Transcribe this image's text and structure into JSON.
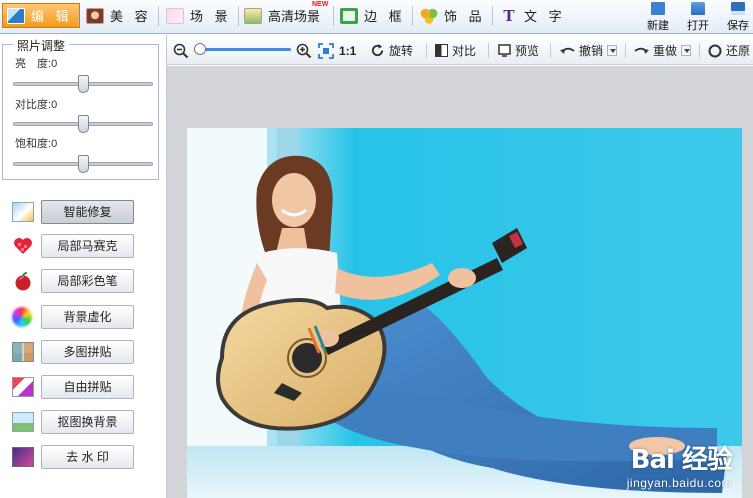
{
  "menu": {
    "tabs": [
      {
        "label": "编 辑",
        "icon": "edit-icon"
      },
      {
        "label": "美 容",
        "icon": "beauty-icon"
      },
      {
        "label": "场 景",
        "icon": "scene-icon"
      },
      {
        "label": "高清场景",
        "icon": "hd-scene-icon"
      },
      {
        "label": "边 框",
        "icon": "frame-icon"
      },
      {
        "label": "饰 品",
        "icon": "accessory-icon"
      },
      {
        "label": "文 字",
        "icon": "text-icon"
      }
    ],
    "new_badge": "NEW",
    "actions": [
      {
        "label": "新建",
        "icon": "new-file-icon"
      },
      {
        "label": "打开",
        "icon": "open-folder-icon"
      },
      {
        "label": "保存",
        "icon": "save-icon"
      }
    ]
  },
  "adjust": {
    "title": "照片调整",
    "sliders": [
      {
        "label": "亮　度:",
        "value": "0",
        "level": 0.5
      },
      {
        "label": "对比度:",
        "value": "0",
        "level": 0.5
      },
      {
        "label": "饱和度:",
        "value": "0",
        "level": 0.5
      }
    ]
  },
  "tools": [
    {
      "label": "智能修复",
      "icon": "smart-repair-icon",
      "selected": true
    },
    {
      "label": "局部马赛克",
      "icon": "mosaic-heart-icon",
      "selected": false
    },
    {
      "label": "局部彩色笔",
      "icon": "color-pen-apple-icon",
      "selected": false
    },
    {
      "label": "背景虚化",
      "icon": "background-blur-icon",
      "selected": false
    },
    {
      "label": "多图拼贴",
      "icon": "multi-collage-icon",
      "selected": false
    },
    {
      "label": "自由拼贴",
      "icon": "free-collage-icon",
      "selected": false
    },
    {
      "label": "抠图换背景",
      "icon": "cutout-icon",
      "selected": false
    },
    {
      "label": "去 水 印",
      "icon": "remove-watermark-icon",
      "selected": false
    }
  ],
  "toolbar": {
    "zoom_out_icon": "zoom-out-icon",
    "zoom_in_icon": "zoom-in-icon",
    "fit_icon": "fit-screen-icon",
    "actual_size": "1:1",
    "rotate": "旋转",
    "compare": "对比",
    "preview": "预览",
    "undo": "撤销",
    "redo": "重做",
    "restore": "还原"
  },
  "photo": {
    "description_icon": "photo-woman-guitar",
    "watermark_logo": "Bai 经验",
    "watermark_url": "jingyan.baidu.com"
  },
  "colors": {
    "active_tab": "#f39a1a",
    "wall_blue": "#23c2e6",
    "jeans_blue": "#3f7fbf",
    "guitar_wood": "#e7c489"
  }
}
